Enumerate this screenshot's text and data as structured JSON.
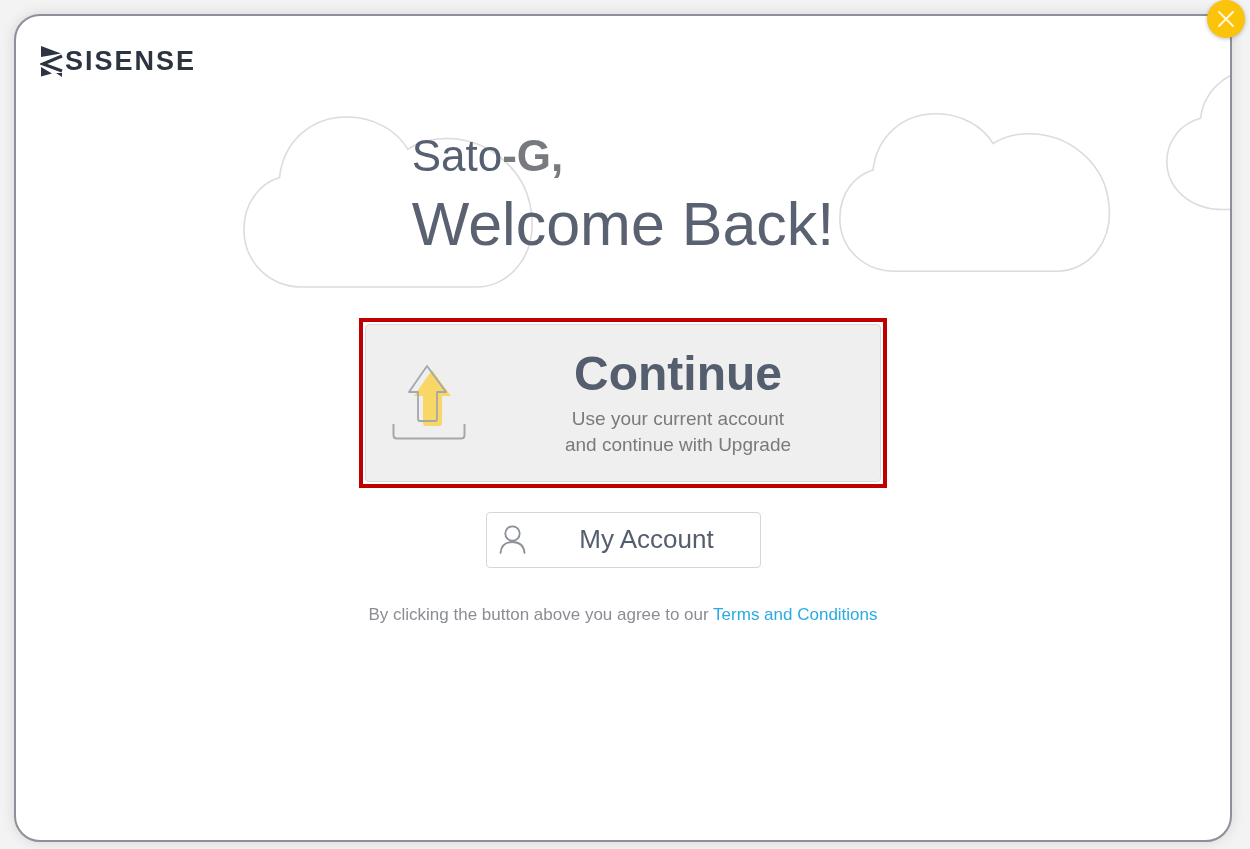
{
  "logo": {
    "text": "SISENSE"
  },
  "greeting": {
    "name": "Sato**-G,**",
    "title": "Welcome Back!"
  },
  "continue_option": {
    "title": "Continue",
    "description": "Use your current account and continue with Upgrade",
    "highlighted": true
  },
  "account_button": {
    "label": "My Account"
  },
  "terms": {
    "text": "By clicking the button above you agree to our",
    "link": "Terms and Conditions"
  }
}
